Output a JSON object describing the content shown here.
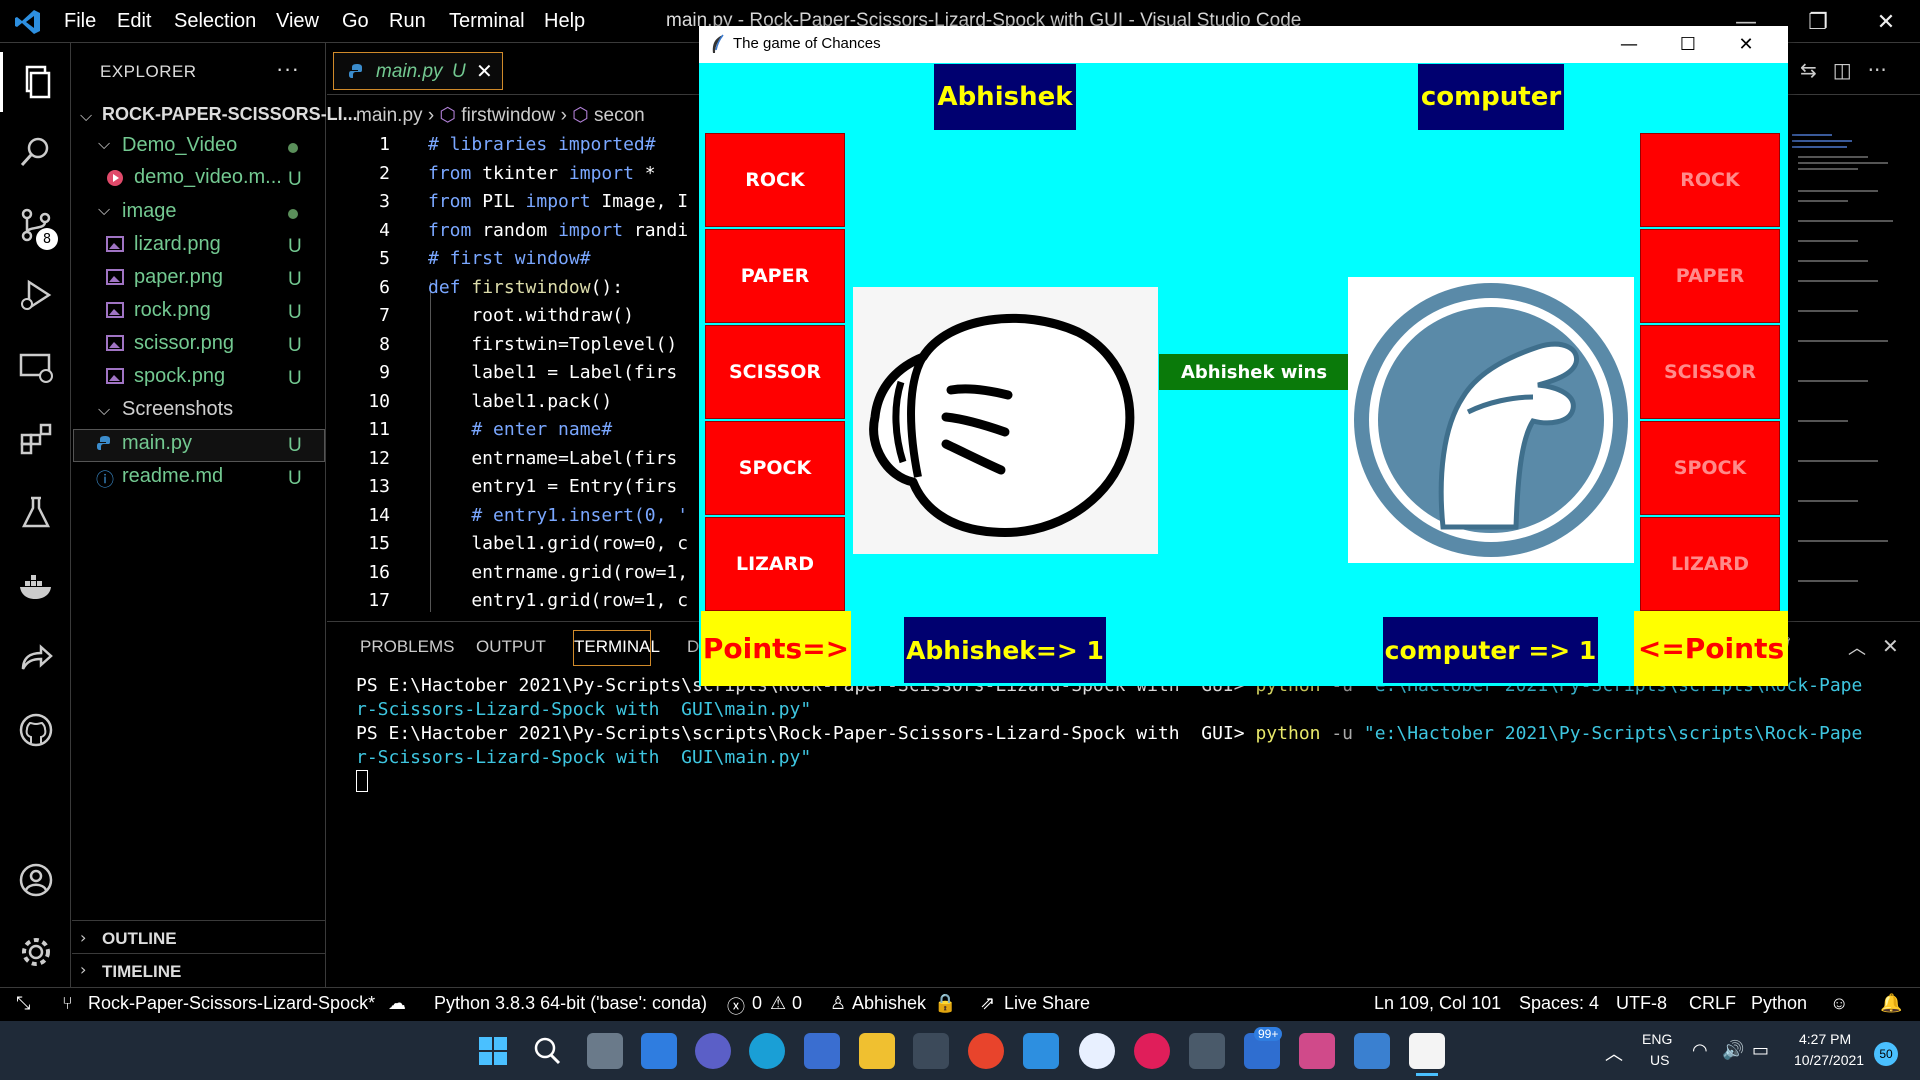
{
  "vscode": {
    "menu": [
      "File",
      "Edit",
      "Selection",
      "View",
      "Go",
      "Run",
      "Terminal",
      "Help"
    ],
    "window_title": "main.py - Rock-Paper-Scissors-Lizard-Spock with GUI - Visual Studio Code",
    "explorer": {
      "header": "EXPLORER",
      "more": "···",
      "root": "ROCK-PAPER-SCISSORS-LI...",
      "items": [
        {
          "label": "Demo_Video",
          "status": ""
        },
        {
          "label": "demo_video.m...",
          "status": "U"
        },
        {
          "label": "image",
          "status": ""
        },
        {
          "label": "lizard.png",
          "status": "U"
        },
        {
          "label": "paper.png",
          "status": "U"
        },
        {
          "label": "rock.png",
          "status": "U"
        },
        {
          "label": "scissor.png",
          "status": "U"
        },
        {
          "label": "spock.png",
          "status": "U"
        },
        {
          "label": "Screenshots",
          "status": ""
        },
        {
          "label": "main.py",
          "status": "U"
        },
        {
          "label": "readme.md",
          "status": "U"
        }
      ],
      "outline": "OUTLINE",
      "timeline": "TIMELINE"
    },
    "source_control_badge": "8",
    "tab": {
      "label": "main.py",
      "status": "U",
      "close": "✕"
    },
    "breadcrumb": [
      "main.py",
      "firstwindow",
      "secon"
    ],
    "code": {
      "lines": [
        "1",
        "2",
        "3",
        "4",
        "5",
        "6",
        "7",
        "8",
        "9",
        "10",
        "11",
        "12",
        "13",
        "14",
        "15",
        "16",
        "17"
      ],
      "l1": "# libraries imported#",
      "l2a": "from",
      "l2b": " tkinter ",
      "l2c": "import",
      "l2d": " *",
      "l3a": "from",
      "l3b": " PIL ",
      "l3c": "import",
      "l3d": " Image, I",
      "l4a": "from",
      "l4b": " random ",
      "l4c": "import",
      "l4d": " randi",
      "l5": "# first window#",
      "l6a": "def",
      "l6b": " firstwindow",
      "l6c": "():",
      "l7": "    root.withdraw()",
      "l8": "    firstwin=Toplevel()",
      "l9": "    label1 = Label(firs",
      "l10": "    label1.pack()",
      "l11": "    # enter name#",
      "l12": "    entrname=Label(firs",
      "l13": "    entry1 = Entry(firs",
      "l14": "    # entry1.insert(0, '",
      "l15": "    label1.grid(row=0, c",
      "l16": "    entrname.grid(row=1,",
      "l17": "    entry1.grid(row=1, c"
    },
    "panel": {
      "tabs": [
        "PROBLEMS",
        "OUTPUT",
        "TERMINAL",
        "D"
      ],
      "term1a": "PS E:\\Hactober 2021\\Py-Scripts\\scripts\\Rock-Paper-Scissors-Lizard-Spock with  GUI> ",
      "term1b": "python",
      "term1c": " -u ",
      "term1d": "\"e:\\Hactober 2021\\Py-Scripts\\scripts\\Rock-Pape",
      "term2": "r-Scissors-Lizard-Spock with  GUI\\main.py\"",
      "term3a": "PS E:\\Hactober 2021\\Py-Scripts\\scripts\\Rock-Paper-Scissors-Lizard-Spock with  GUI> ",
      "term3b": "python",
      "term3c": " -u ",
      "term3d": "\"e:\\Hactober 2021\\Py-Scripts\\scripts\\Rock-Pape",
      "term4": "r-Scissors-Lizard-Spock with  GUI\\main.py\""
    },
    "status": {
      "branch": "Rock-Paper-Scissors-Lizard-Spock*",
      "python": "Python 3.8.3 64-bit ('base': conda)",
      "errors": "0",
      "warnings": "0",
      "user": "Abhishek",
      "liveshare": "Live Share",
      "position": "Ln 109, Col 101",
      "spaces": "Spaces: 4",
      "encoding": "UTF-8",
      "eol": "CRLF",
      "language": "Python"
    }
  },
  "game": {
    "title": "The game of Chances",
    "player_name": "Abhishek",
    "computer_name": "computer",
    "choices": [
      "ROCK",
      "PAPER",
      "SCISSOR",
      "SPOCK",
      "LIZARD"
    ],
    "result": "Abhishek wins",
    "points_left": "Points=>",
    "points_right": "<=Points",
    "player_score": "Abhishek=> 1",
    "computer_score": "computer => 1"
  },
  "taskbar": {
    "lang1": "ENG",
    "lang2": "US",
    "time": "4:27 PM",
    "date": "10/27/2021",
    "notif": "50",
    "mail_badge": "99+"
  },
  "colors": {
    "game_bg": "#00ffff",
    "red_button": "#ff0000",
    "navy_label": "#000070",
    "yellow_label": "#ffff00",
    "result_green": "#0a7a0a",
    "git_untracked": "#73c991"
  }
}
